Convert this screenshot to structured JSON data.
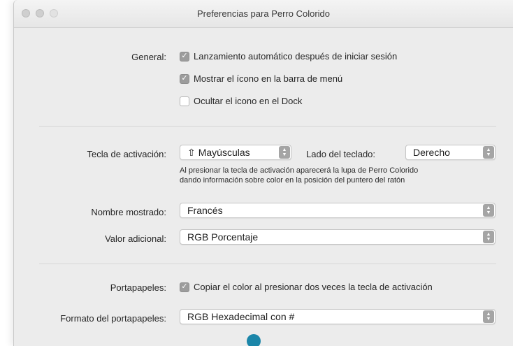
{
  "window": {
    "title": "Preferencias para Perro Colorido"
  },
  "general": {
    "label": "General:",
    "options": [
      {
        "label": "Lanzamiento automático después de iniciar sesión",
        "checked": true
      },
      {
        "label": "Mostrar el ícono en la barra de menú",
        "checked": true
      },
      {
        "label": "Ocultar el icono en el Dock",
        "checked": false
      }
    ]
  },
  "activation": {
    "label": "Tecla de activación:",
    "key_icon": "shift-icon",
    "key_value": "Mayúsculas",
    "side_label": "Lado del teclado:",
    "side_value": "Derecho",
    "help_line1": "Al presionar la tecla de activación aparecerá la lupa de Perro Colorido",
    "help_line2": "dando información sobre color en la posición del puntero del ratón"
  },
  "display_name": {
    "label": "Nombre mostrado:",
    "value": "Francés"
  },
  "extra_value": {
    "label": "Valor adicional:",
    "value": "RGB Porcentaje"
  },
  "clipboard": {
    "label": "Portapapeles:",
    "option": "Copiar el color al presionar dos veces la tecla de activación",
    "checked": true,
    "format_label": "Formato del portapapeles:",
    "format_value": "RGB Hexadecimal con #"
  },
  "colors": {
    "accent": "#1b86a9",
    "checkbox_on": "#9c9c9c",
    "window_bg": "#ececec"
  }
}
